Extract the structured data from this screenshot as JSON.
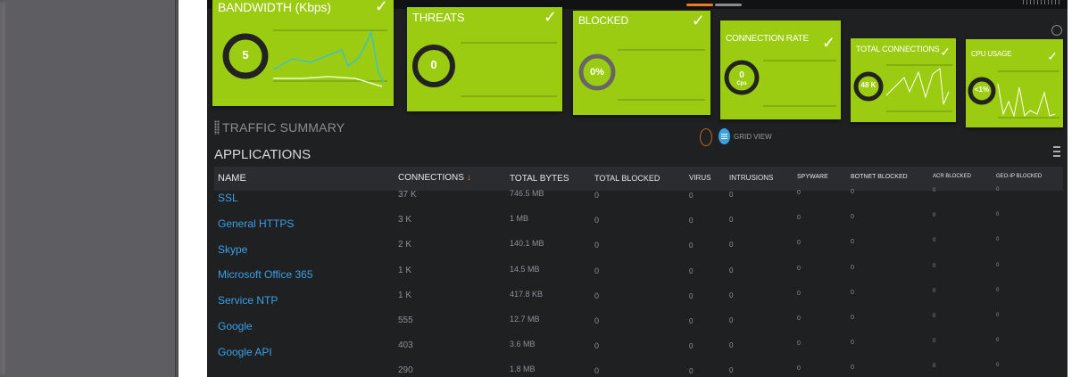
{
  "cards": [
    {
      "title": "BANDWIDTH (Kbps)",
      "value": "5",
      "check": "✓"
    },
    {
      "title": "THREATS",
      "value": "0",
      "check": "✓"
    },
    {
      "title": "BLOCKED",
      "value": "0%",
      "check": "✓"
    },
    {
      "title": "CONNECTION RATE",
      "value": "0",
      "unit": "Cps",
      "check": "✓"
    },
    {
      "title": "TOTAL CONNECTIONS",
      "value": "48 K",
      "check": "✓"
    },
    {
      "title": "CPU USAGE",
      "value": "<1%",
      "check": "✓"
    }
  ],
  "traffic_summary": {
    "title": "TRAFFIC SUMMARY",
    "view_label": "GRID VIEW"
  },
  "applications": {
    "title": "APPLICATIONS",
    "columns": [
      "NAME",
      "CONNECTIONS",
      "TOTAL BYTES",
      "TOTAL BLOCKED",
      "VIRUS",
      "INTRUSIONS",
      "SPYWARE",
      "BOTNET BLOCKED",
      "ACR BLOCKED",
      "GEO-IP BLOCKED"
    ],
    "sort_indicator": "↓",
    "rows": [
      {
        "name": "SSL",
        "connections": "37 K",
        "bytes": "746.5 MB",
        "blocked": "0",
        "virus": "0",
        "intrusions": "0",
        "spyware": "0",
        "botnet": "0",
        "acr": "0",
        "geoip": "0"
      },
      {
        "name": "General HTTPS",
        "connections": "3 K",
        "bytes": "1 MB",
        "blocked": "0",
        "virus": "0",
        "intrusions": "0",
        "spyware": "0",
        "botnet": "0",
        "acr": "0",
        "geoip": "0"
      },
      {
        "name": "Skype",
        "connections": "2 K",
        "bytes": "140.1 MB",
        "blocked": "0",
        "virus": "0",
        "intrusions": "0",
        "spyware": "0",
        "botnet": "0",
        "acr": "0",
        "geoip": "0"
      },
      {
        "name": "Microsoft Office 365",
        "connections": "1 K",
        "bytes": "14.5 MB",
        "blocked": "0",
        "virus": "0",
        "intrusions": "0",
        "spyware": "0",
        "botnet": "0",
        "acr": "0",
        "geoip": "0"
      },
      {
        "name": "Service NTP",
        "connections": "1 K",
        "bytes": "417.8 KB",
        "blocked": "0",
        "virus": "0",
        "intrusions": "0",
        "spyware": "0",
        "botnet": "0",
        "acr": "0",
        "geoip": "0"
      },
      {
        "name": "Google",
        "connections": "555",
        "bytes": "12.7 MB",
        "blocked": "0",
        "virus": "0",
        "intrusions": "0",
        "spyware": "0",
        "botnet": "0",
        "acr": "0",
        "geoip": "0"
      },
      {
        "name": "Google API",
        "connections": "403",
        "bytes": "3.6 MB",
        "blocked": "0",
        "virus": "0",
        "intrusions": "0",
        "spyware": "0",
        "botnet": "0",
        "acr": "0",
        "geoip": "0"
      },
      {
        "name": "",
        "connections": "290",
        "bytes": "1.8 MB",
        "blocked": "0",
        "virus": "0",
        "intrusions": "0",
        "spyware": "0",
        "botnet": "0",
        "acr": "0",
        "geoip": "0"
      }
    ]
  },
  "colors": {
    "card_green": "#9ccc12",
    "link_blue": "#3aa0e6",
    "accent_orange": "#f07a22",
    "panel_dark": "#1f2022"
  }
}
